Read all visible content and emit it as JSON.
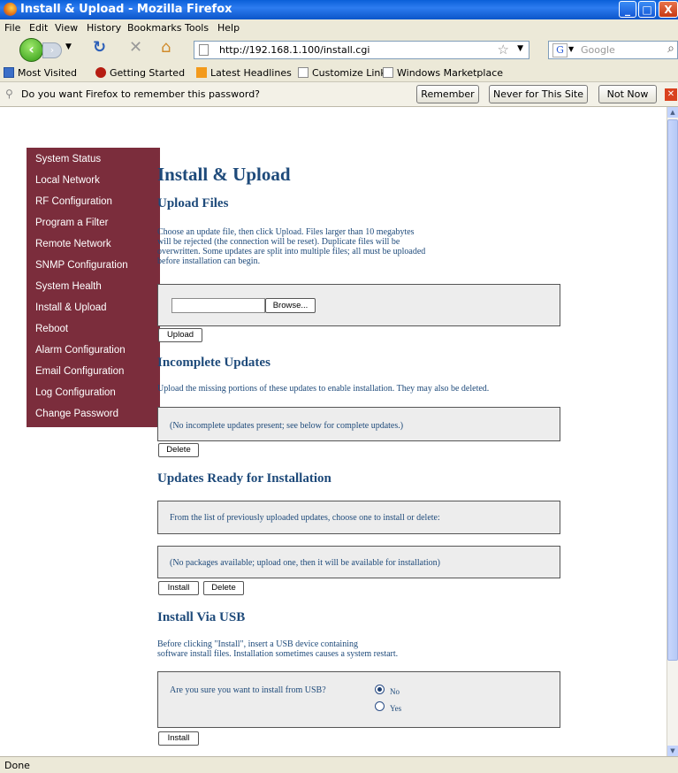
{
  "window": {
    "title": "Install & Upload - Mozilla Firefox",
    "controls": {
      "minimize": "_",
      "maximize": "□",
      "close": "X"
    }
  },
  "menu": [
    "File",
    "Edit",
    "View",
    "History",
    "Bookmarks",
    "Tools",
    "Help"
  ],
  "nav": {
    "url": "http://192.168.1.100/install.cgi",
    "search_placeholder": "Google"
  },
  "bookmarks": [
    "Most Visited",
    "Getting Started",
    "Latest Headlines",
    "Customize Links",
    "Windows Marketplace"
  ],
  "password_bar": {
    "message": "Do you want Firefox to remember this password?",
    "remember": "Remember",
    "never": "Never for This Site",
    "not_now": "Not Now"
  },
  "sidebar": {
    "items": [
      "System Status",
      "Local Network",
      "RF Configuration",
      "Program a Filter",
      "Remote Network",
      "SNMP Configuration",
      "System Health",
      "Install & Upload",
      "Reboot",
      "Alarm Configuration",
      "Email Configuration",
      "Log Configuration",
      "Change Password"
    ]
  },
  "page": {
    "title": "Install & Upload",
    "upload": {
      "heading": "Upload Files",
      "lines": [
        "Choose an update file, then click Upload. Files larger than 10 megabytes",
        "will be rejected (the connection will be reset). Duplicate files will be",
        "overwritten. Some updates are split into multiple files; all must be uploaded",
        "before installation can begin."
      ],
      "browse_label": "Browse...",
      "upload_label": "Upload"
    },
    "incomplete": {
      "heading": "Incomplete Updates",
      "text": "Upload the missing portions of these updates to enable installation. They may also be deleted.",
      "box_text": "(No incomplete updates present; see below for complete updates.)",
      "delete_label": "Delete"
    },
    "ready": {
      "heading": "Updates Ready for Installation",
      "choose_text": "From the list of previously uploaded updates, choose one to install or delete:",
      "none_text": "(No packages available; upload one, then it will be available for installation)",
      "install_label": "Install",
      "delete_label": "Delete"
    },
    "usb": {
      "heading": "Install Via USB",
      "lines": [
        "Before clicking \"Install\", insert a USB device containing",
        "software install files. Installation sometimes causes a system restart."
      ],
      "question": "Are you sure you want to install from USB?",
      "option_no": "No",
      "option_yes": "Yes",
      "selected": "No",
      "install_label": "Install"
    }
  },
  "status": "Done"
}
